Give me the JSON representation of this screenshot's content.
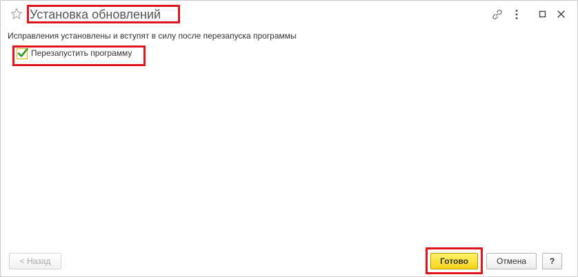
{
  "window": {
    "title": "Установка обновлений",
    "icons": [
      "star-icon",
      "link-icon",
      "more-icon",
      "maximize-icon",
      "close-icon"
    ]
  },
  "main": {
    "message": "Исправления установлены и вступят в силу после перезапуска программы",
    "restart_checkbox": {
      "label": "Перезапустить программу",
      "checked": true
    }
  },
  "footer": {
    "back_label": "< Назад",
    "ready_label": "Готово",
    "cancel_label": "Отмена",
    "help_label": "?"
  },
  "colors": {
    "highlight": "#e0141b",
    "primary_button": "#f9d31a",
    "check": "#2a9a2a"
  }
}
